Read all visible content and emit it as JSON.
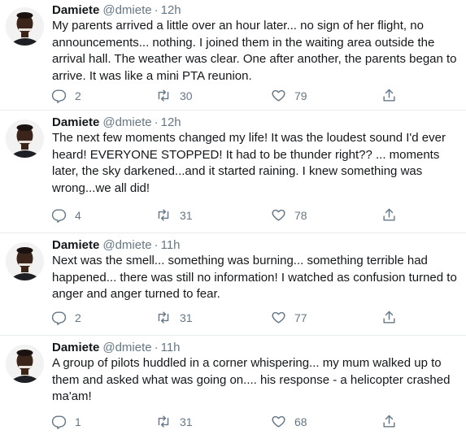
{
  "tweets": [
    {
      "name": "Damiete",
      "handle": "@dmiete",
      "separator": "·",
      "time": "12h",
      "text": "My parents arrived a little over an hour later... no sign of her flight, no announcements... nothing.  I joined them in the waiting area outside the arrival hall. The weather was clear. One after another, the parents began to arrive.  It was like a mini PTA reunion.",
      "replies": "2",
      "retweets": "30",
      "likes": "79"
    },
    {
      "name": "Damiete",
      "handle": "@dmiete",
      "separator": "·",
      "time": "12h",
      "text": "The next few moments changed my life! It was the loudest sound I'd ever heard! EVERYONE STOPPED! It had to be thunder right?? ... moments later, the sky darkened...and it started raining. I knew something was wrong...we all did!",
      "replies": "4",
      "retweets": "31",
      "likes": "78"
    },
    {
      "name": "Damiete",
      "handle": "@dmiete",
      "separator": "·",
      "time": "11h",
      "text": "Next was the smell... something was burning... something terrible had happened... there was still no information! I watched as confusion turned to anger and anger turned to fear.",
      "replies": "2",
      "retweets": "31",
      "likes": "77"
    },
    {
      "name": "Damiete",
      "handle": "@dmiete",
      "separator": "·",
      "time": "11h",
      "text": "A group of pilots huddled in a corner whispering... my mum walked up to them and asked what was going on.... his response - a helicopter crashed ma'am!",
      "replies": "1",
      "retweets": "31",
      "likes": "68"
    }
  ],
  "colors": {
    "text": "#14171a",
    "secondary": "#657786",
    "divider": "#e6ecf0"
  },
  "icons": [
    "reply-icon",
    "retweet-icon",
    "like-icon",
    "share-icon"
  ]
}
